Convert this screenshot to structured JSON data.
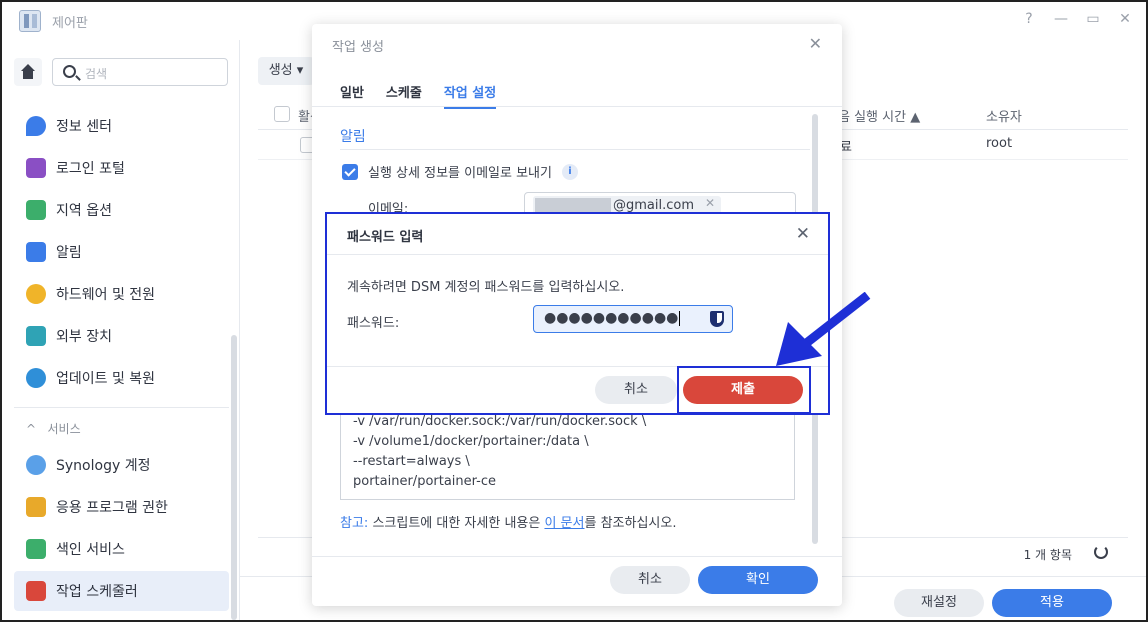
{
  "window": {
    "title": "제어판",
    "controls": [
      "?",
      "—",
      "▭",
      "✕"
    ]
  },
  "sidebar": {
    "search_placeholder": "검색",
    "items": [
      {
        "label": "정보 센터",
        "icon": "info-icon",
        "color": "#3b7ce8"
      },
      {
        "label": "로그인 포털",
        "icon": "login-portal-icon",
        "color": "#8a4fc4"
      },
      {
        "label": "지역 옵션",
        "icon": "region-icon",
        "color": "#3cae6b"
      },
      {
        "label": "알림",
        "icon": "notification-icon",
        "color": "#3b7ce8"
      },
      {
        "label": "하드웨어 및 전원",
        "icon": "hardware-bulb-icon",
        "color": "#f0b429"
      },
      {
        "label": "외부 장치",
        "icon": "external-device-icon",
        "color": "#2fa3b5"
      },
      {
        "label": "업데이트 및 복원",
        "icon": "update-icon",
        "color": "#2f8fd8"
      }
    ],
    "services_header": "서비스",
    "service_items": [
      {
        "label": "Synology 계정",
        "icon": "synology-account-icon",
        "color": "#5aa0e8"
      },
      {
        "label": "응용 프로그램 권한",
        "icon": "lock-icon",
        "color": "#e8a92a"
      },
      {
        "label": "색인 서비스",
        "icon": "index-service-icon",
        "color": "#3cae6b"
      },
      {
        "label": "작업 스케줄러",
        "icon": "calendar-icon",
        "color": "#d9473b"
      }
    ]
  },
  "background": {
    "create_label": "생성",
    "col_enabled": "활성",
    "col_next_run": "음 실행 시간 ▲",
    "col_owner": "소유자",
    "row_next_run": "료",
    "row_owner": "root",
    "count": "1 개 항목",
    "reset_label": "재설정",
    "apply_label": "적용"
  },
  "task_dialog": {
    "title": "작업 생성",
    "tabs": [
      "일반",
      "스케줄",
      "작업 설정"
    ],
    "active_tab": "작업 설정",
    "section_title": "알림",
    "email_checkbox_label": "실행 상세 정보를 이메일로 보내기",
    "email_label": "이메일:",
    "email_value": "@gmail.com",
    "script_lines": [
      "-v /var/run/docker.sock:/var/run/docker.sock \\",
      "-v /volume1/docker/portainer:/data \\",
      "--restart=always \\",
      "portainer/portainer-ce"
    ],
    "note_label": "참고:",
    "note_before": " 스크립트에 대한 자세한 내용은 ",
    "note_link": "이 문서",
    "note_after": "를 참조하십시오.",
    "cancel_label": "취소",
    "ok_label": "확인"
  },
  "password_dialog": {
    "title": "패스워드 입력",
    "message": "계속하려면 DSM 계정의 패스워드를 입력하십시오.",
    "password_label": "패스워드:",
    "password_value": "●●●●●●●●●●●",
    "cancel_label": "취소",
    "submit_label": "제출"
  },
  "colors": {
    "accent": "#3b7ce8",
    "submit": "#d9473b",
    "highlight_frame": "#1e2fd6"
  }
}
